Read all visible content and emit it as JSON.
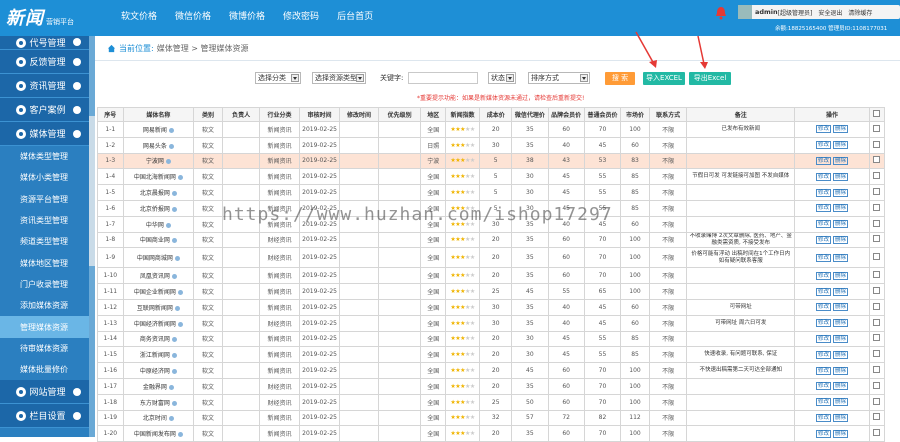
{
  "header": {
    "logo": "新闻",
    "logo_sub": "营销平台",
    "nav": [
      "软文价格",
      "微信价格",
      "微博价格",
      "修改密码",
      "后台首页"
    ],
    "user": {
      "name": "admin",
      "role": "[超级管理员]",
      "logout": "安全退出",
      "clear": "清除缓存"
    },
    "info": "余额:18825165400  管理员ID:1108177031"
  },
  "sidebar": {
    "groups": [
      {
        "label": "代号管理",
        "items": []
      },
      {
        "label": "反馈管理",
        "items": []
      },
      {
        "label": "资讯管理",
        "items": []
      },
      {
        "label": "客户案例",
        "items": []
      },
      {
        "label": "媒体管理",
        "items": [
          "媒体类型管理",
          "媒体小类管理",
          "资源平台管理",
          "资讯类型管理",
          "频道类型管理",
          "媒体地区管理",
          "门户收录管理",
          "添加媒体资源",
          "管理媒体资源",
          "待审媒体资源",
          "媒体批量修价"
        ]
      },
      {
        "label": "网站管理",
        "items": []
      },
      {
        "label": "栏目设置",
        "items": []
      }
    ],
    "active_item": "管理媒体资源"
  },
  "breadcrumb": {
    "label": "当前位置:",
    "path": "媒体管理 > 管理媒体资源"
  },
  "filters": {
    "platform": "选择分类",
    "subcategory": "选择资源类型",
    "keyword_label": "关键字:",
    "keyword_value": "",
    "status": "状态",
    "sort": "排序方式",
    "search_btn": "搜 索",
    "import_btn": "导入EXCEL",
    "export_btn": "导出Excel"
  },
  "notice": "*重要提示功能：如果是新媒体资源未通过，请检查后重新提交!",
  "table": {
    "headers": [
      "序号",
      "媒体名称",
      "类别",
      "负责人",
      "行业分类",
      "审核时间",
      "修改时间",
      "优先级别",
      "地区",
      "新闻指数",
      "成本价",
      "微信代理价",
      "品牌会员价",
      "普通会员价",
      "市场价",
      "联系方式",
      "备注",
      "操作",
      ""
    ],
    "rows": [
      {
        "id": "1-1",
        "name": "网易新闻",
        "cat": "软文",
        "owner": "",
        "industry": "新闻资讯",
        "audit": "2019-02-25",
        "mod": "",
        "priority": "",
        "region": "全国",
        "stars": 3,
        "cost": "20",
        "wx": "35",
        "brand": "60",
        "normal": "70",
        "market": "100",
        "contact": "不限",
        "note": "已发布有效新闻",
        "hl": false
      },
      {
        "id": "1-2",
        "name": "网易头条",
        "cat": "软文",
        "owner": "",
        "industry": "新闻资讯",
        "audit": "2019-02-25",
        "mod": "",
        "priority": "",
        "region": "日照",
        "stars": 3,
        "cost": "30",
        "wx": "35",
        "brand": "40",
        "normal": "45",
        "market": "60",
        "contact": "不限",
        "note": "",
        "hl": false
      },
      {
        "id": "1-3",
        "name": "宁波网",
        "cat": "软文",
        "owner": "",
        "industry": "新闻资讯",
        "audit": "2019-02-25",
        "mod": "",
        "priority": "",
        "region": "宁波",
        "stars": 3,
        "cost": "5",
        "wx": "38",
        "brand": "43",
        "normal": "53",
        "market": "83",
        "contact": "不限",
        "note": "",
        "hl": true
      },
      {
        "id": "1-4",
        "name": "中国北海新闻网",
        "cat": "软文",
        "owner": "",
        "industry": "新闻资讯",
        "audit": "2019-02-25",
        "mod": "",
        "priority": "",
        "region": "全国",
        "stars": 3,
        "cost": "5",
        "wx": "30",
        "brand": "45",
        "normal": "55",
        "market": "85",
        "contact": "不限",
        "note": "节假日可发 可发链接可加图 不发自媒体",
        "hl": false
      },
      {
        "id": "1-5",
        "name": "北京晨报网",
        "cat": "软文",
        "owner": "",
        "industry": "新闻资讯",
        "audit": "2019-02-25",
        "mod": "",
        "priority": "",
        "region": "全国",
        "stars": 3,
        "cost": "5",
        "wx": "30",
        "brand": "45",
        "normal": "55",
        "market": "85",
        "contact": "不限",
        "note": "",
        "hl": false
      },
      {
        "id": "1-6",
        "name": "北京侨报网",
        "cat": "软文",
        "owner": "",
        "industry": "新闻资讯",
        "audit": "2019-02-25",
        "mod": "",
        "priority": "",
        "region": "全国",
        "stars": 3,
        "cost": "5",
        "wx": "30",
        "brand": "45",
        "normal": "55",
        "market": "85",
        "contact": "不限",
        "note": "",
        "hl": false
      },
      {
        "id": "1-7",
        "name": "中华网",
        "cat": "软文",
        "owner": "",
        "industry": "新闻资讯",
        "audit": "2019-02-25",
        "mod": "",
        "priority": "",
        "region": "全国",
        "stars": 3,
        "cost": "30",
        "wx": "35",
        "brand": "40",
        "normal": "45",
        "market": "60",
        "contact": "不限",
        "note": "",
        "hl": false
      },
      {
        "id": "1-8",
        "name": "中国商业网",
        "cat": "软文",
        "owner": "",
        "industry": "财经资讯",
        "audit": "2019-02-25",
        "mod": "",
        "priority": "",
        "region": "全国",
        "stars": 3,
        "cost": "20",
        "wx": "35",
        "brand": "60",
        "normal": "70",
        "market": "100",
        "contact": "不限",
        "note": "不收录赌博 2次文章删除, 医药、地产、金融类需资质, 不接受发布",
        "hl": false
      },
      {
        "id": "1-9",
        "name": "中国网商城网",
        "cat": "软文",
        "owner": "",
        "industry": "财经资讯",
        "audit": "2019-02-25",
        "mod": "",
        "priority": "",
        "region": "全国",
        "stars": 3,
        "cost": "20",
        "wx": "35",
        "brand": "60",
        "normal": "70",
        "market": "100",
        "contact": "不限",
        "note": "价格可能有浮动 出稿时间在1个工作日内 如有疑问联系客服",
        "hl": false,
        "tall": true
      },
      {
        "id": "1-10",
        "name": "凤凰资讯网",
        "cat": "软文",
        "owner": "",
        "industry": "新闻资讯",
        "audit": "2019-02-25",
        "mod": "",
        "priority": "",
        "region": "全国",
        "stars": 3,
        "cost": "20",
        "wx": "35",
        "brand": "60",
        "normal": "70",
        "market": "100",
        "contact": "不限",
        "note": "",
        "hl": false
      },
      {
        "id": "1-11",
        "name": "中国企业新闻网",
        "cat": "软文",
        "owner": "",
        "industry": "新闻资讯",
        "audit": "2019-02-25",
        "mod": "",
        "priority": "",
        "region": "全国",
        "stars": 3,
        "cost": "25",
        "wx": "45",
        "brand": "55",
        "normal": "65",
        "market": "100",
        "contact": "不限",
        "note": "",
        "hl": false
      },
      {
        "id": "1-12",
        "name": "互联网新闻网",
        "cat": "软文",
        "owner": "",
        "industry": "新闻资讯",
        "audit": "2019-02-25",
        "mod": "",
        "priority": "",
        "region": "全国",
        "stars": 3,
        "cost": "30",
        "wx": "35",
        "brand": "40",
        "normal": "45",
        "market": "60",
        "contact": "不限",
        "note": "可带网址",
        "hl": false
      },
      {
        "id": "1-13",
        "name": "中国经济新闻网",
        "cat": "软文",
        "owner": "",
        "industry": "财经资讯",
        "audit": "2019-02-25",
        "mod": "",
        "priority": "",
        "region": "全国",
        "stars": 3,
        "cost": "30",
        "wx": "35",
        "brand": "40",
        "normal": "45",
        "market": "60",
        "contact": "不限",
        "note": "可带网址 周六日可发",
        "hl": false
      },
      {
        "id": "1-14",
        "name": "商务资讯网",
        "cat": "软文",
        "owner": "",
        "industry": "新闻资讯",
        "audit": "2019-02-25",
        "mod": "",
        "priority": "",
        "region": "全国",
        "stars": 3,
        "cost": "20",
        "wx": "30",
        "brand": "45",
        "normal": "55",
        "market": "85",
        "contact": "不限",
        "note": "",
        "hl": false
      },
      {
        "id": "1-15",
        "name": "浙江新闻网",
        "cat": "软文",
        "owner": "",
        "industry": "新闻资讯",
        "audit": "2019-02-25",
        "mod": "",
        "priority": "",
        "region": "全国",
        "stars": 3,
        "cost": "20",
        "wx": "30",
        "brand": "45",
        "normal": "55",
        "market": "85",
        "contact": "不限",
        "note": "快速收录, 有问题可联系, 保证",
        "hl": false
      },
      {
        "id": "1-16",
        "name": "中原经济网",
        "cat": "软文",
        "owner": "",
        "industry": "新闻资讯",
        "audit": "2019-02-25",
        "mod": "",
        "priority": "",
        "region": "全国",
        "stars": 3,
        "cost": "20",
        "wx": "45",
        "brand": "60",
        "normal": "70",
        "market": "100",
        "contact": "不限",
        "note": "不快速出稿需第二天可达全部通知",
        "hl": false
      },
      {
        "id": "1-17",
        "name": "金融界网",
        "cat": "软文",
        "owner": "",
        "industry": "财经资讯",
        "audit": "2019-02-25",
        "mod": "",
        "priority": "",
        "region": "全国",
        "stars": 3,
        "cost": "20",
        "wx": "35",
        "brand": "60",
        "normal": "70",
        "market": "100",
        "contact": "不限",
        "note": "",
        "hl": false
      },
      {
        "id": "1-18",
        "name": "东方财富网",
        "cat": "软文",
        "owner": "",
        "industry": "财经资讯",
        "audit": "2019-02-25",
        "mod": "",
        "priority": "",
        "region": "全国",
        "stars": 3,
        "cost": "25",
        "wx": "50",
        "brand": "60",
        "normal": "70",
        "market": "100",
        "contact": "不限",
        "note": "",
        "hl": false
      },
      {
        "id": "1-19",
        "name": "北京时间",
        "cat": "软文",
        "owner": "",
        "industry": "新闻资讯",
        "audit": "2019-02-25",
        "mod": "",
        "priority": "",
        "region": "全国",
        "stars": 3,
        "cost": "32",
        "wx": "57",
        "brand": "72",
        "normal": "82",
        "market": "112",
        "contact": "不限",
        "note": "",
        "hl": false
      },
      {
        "id": "1-20",
        "name": "中国新闻发布网",
        "cat": "软文",
        "owner": "",
        "industry": "新闻资讯",
        "audit": "2019-02-25",
        "mod": "",
        "priority": "",
        "region": "全国",
        "stars": 3,
        "cost": "20",
        "wx": "35",
        "brand": "60",
        "normal": "70",
        "market": "100",
        "contact": "不限",
        "note": "",
        "hl": false
      }
    ],
    "edit_label": "修改",
    "delete_label": "删除"
  },
  "watermark": "https://www.huzhan.com/ishop17297",
  "colors": {
    "header": "#1e8fd6",
    "sidebar": "#2b7fc0",
    "search_btn": "#ff9b36",
    "excel_btn": "#22b9a4",
    "highlight_row": "#fde3d5",
    "notice": "#e53935"
  }
}
